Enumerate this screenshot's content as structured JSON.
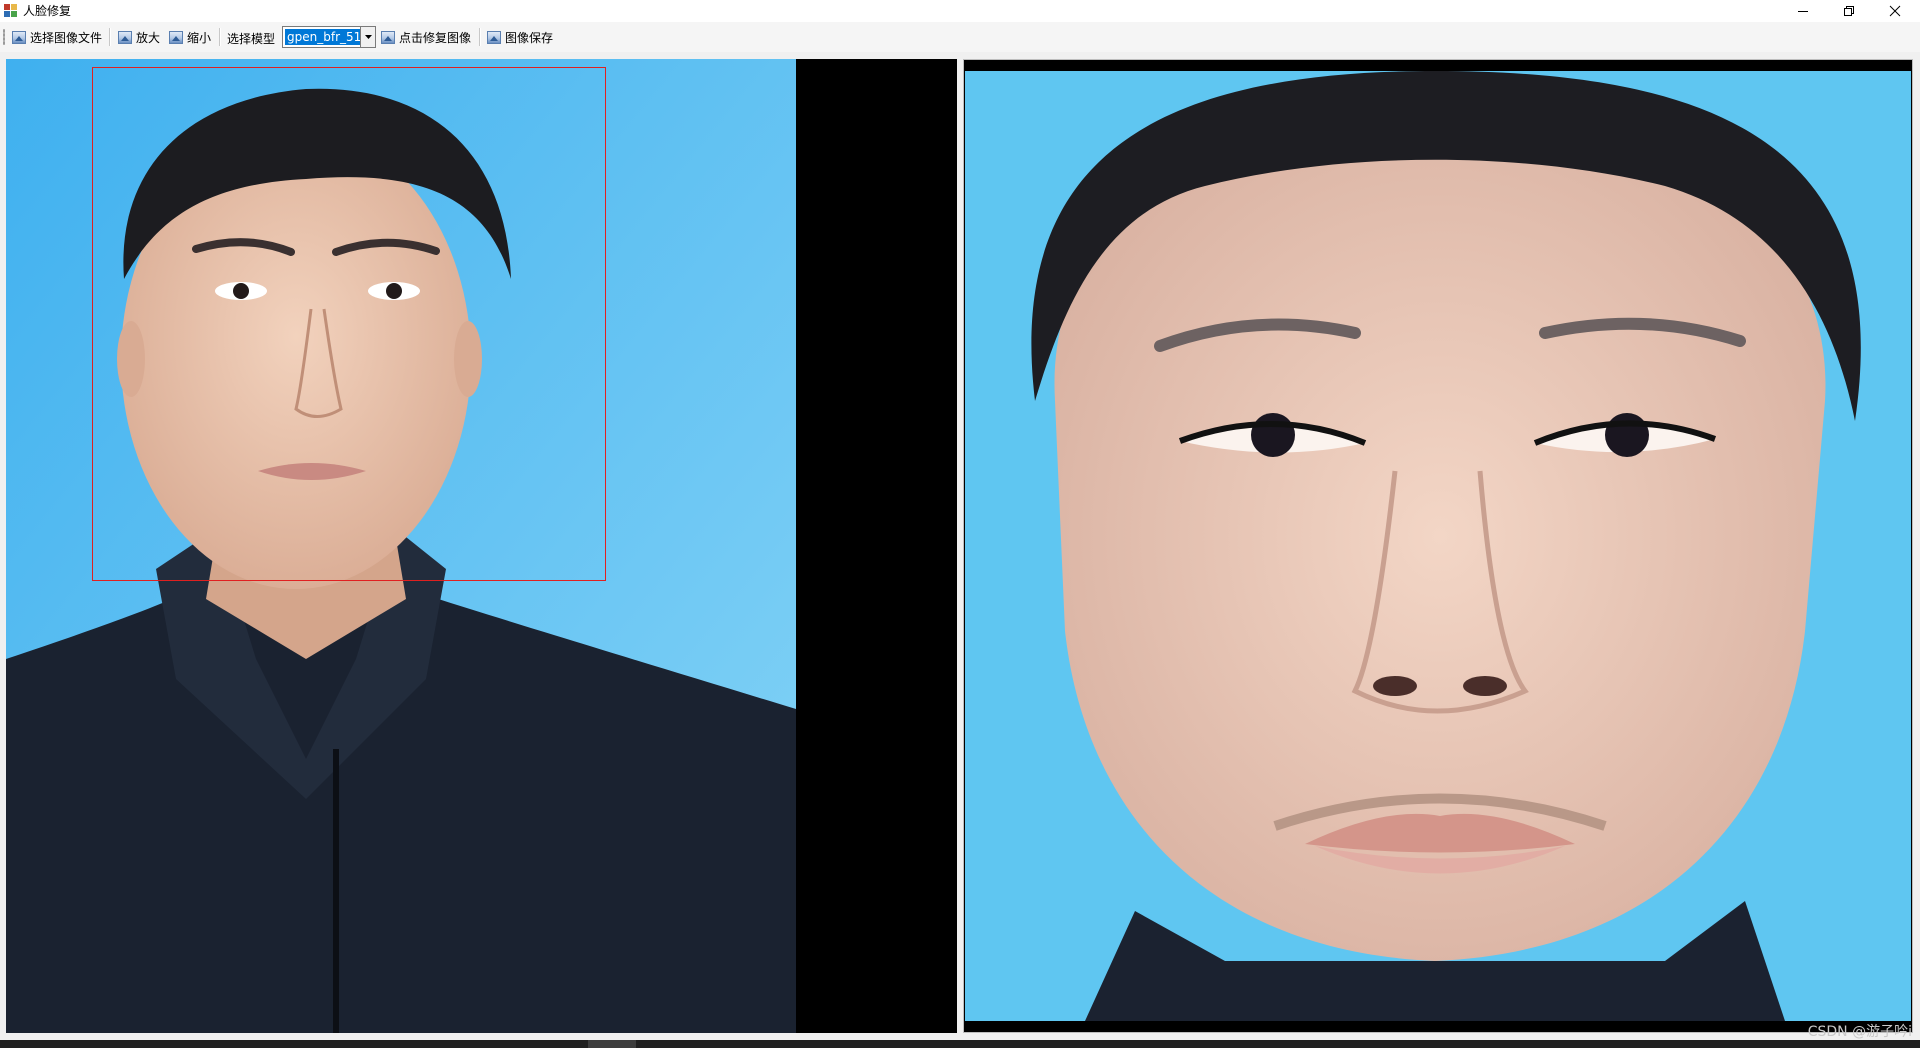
{
  "window": {
    "title": "人脸修复",
    "controls": [
      "minimize-icon",
      "restore-icon",
      "close-icon"
    ]
  },
  "toolbar": {
    "open_label": "选择图像文件",
    "zoom_in_label": "放大",
    "zoom_out_label": "缩小",
    "model_label": "选择模型",
    "model_value": "gpen_bfr_51",
    "restore_label": "点击修复图像",
    "save_label": "图像保存"
  },
  "panels": {
    "left": "original-image",
    "right": "restored-image"
  },
  "colors": {
    "accent": "#0078d7",
    "face_box": "#e02020",
    "background_blue": "#5cc1f0"
  },
  "watermark": "CSDN @游子吟i"
}
